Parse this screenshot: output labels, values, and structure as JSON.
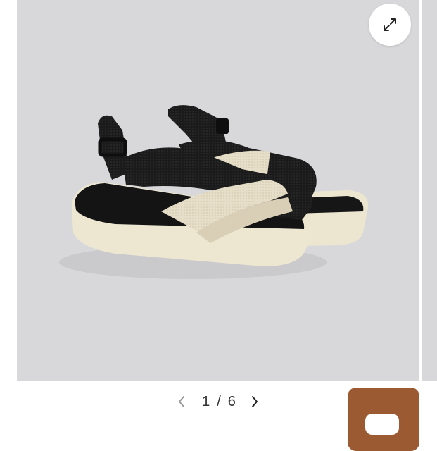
{
  "gallery": {
    "expand_icon": "expand-arrows-icon",
    "image_alt_icon": "product-photo"
  },
  "pager": {
    "prev_icon": "chevron-left-icon",
    "next_icon": "chevron-right-icon",
    "current": "1",
    "separator": "/",
    "total": "6"
  },
  "chat": {
    "icon": "chat-bubble-icon",
    "color": "#9b5a32"
  },
  "colors": {
    "gallery_bg": "#d8d8da",
    "sandal_black": "#1a1a1a",
    "sole_cream": "#ede7d2",
    "strap_cream": "#e8e0cc"
  }
}
